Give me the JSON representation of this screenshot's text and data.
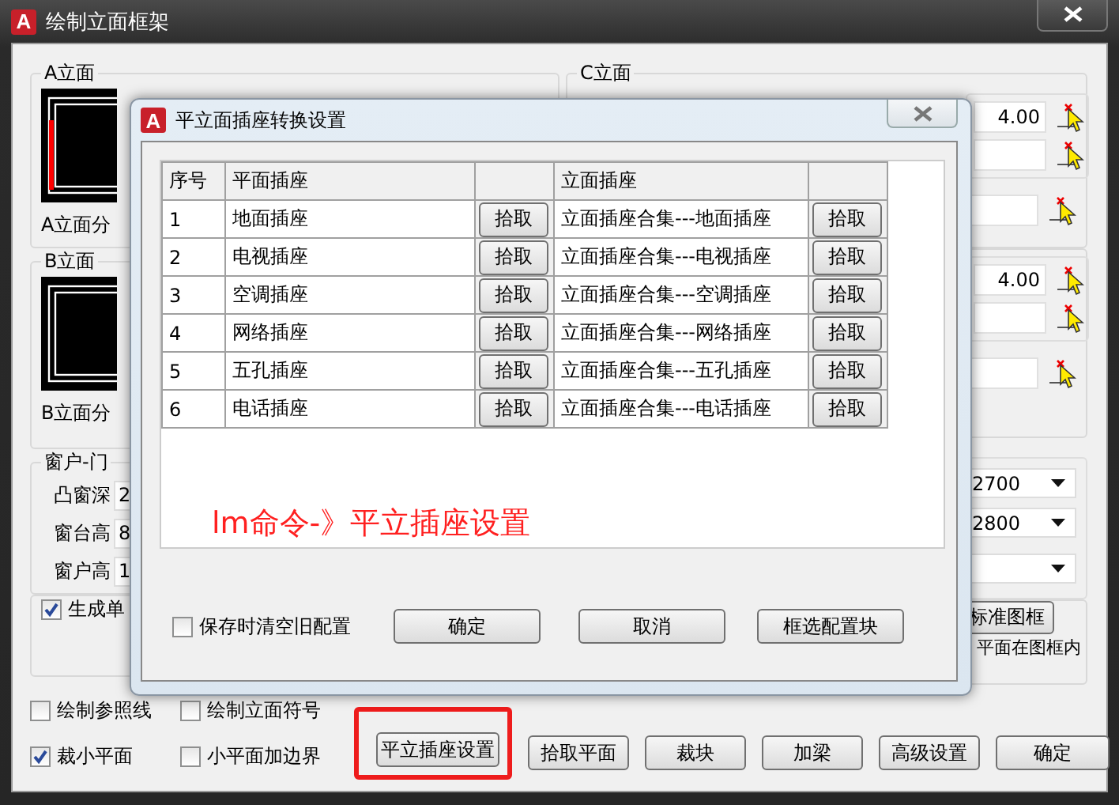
{
  "main_window": {
    "logo": "A",
    "title": "绘制立面框架"
  },
  "left_groups": [
    {
      "label": "A立面",
      "divider_label": "A立面分",
      "red_edge": true
    },
    {
      "label": "B立面",
      "divider_label": "B立面分",
      "red_edge": false
    }
  ],
  "right_groups": [
    {
      "label": "C立面",
      "rows": [
        {
          "kind": "filled",
          "value": "4.00"
        },
        {
          "kind": "empty"
        },
        {
          "kind": "empty"
        }
      ]
    },
    {
      "rows": [
        {
          "kind": "filled",
          "value": "4.00"
        },
        {
          "kind": "empty"
        },
        {
          "kind": "empty"
        }
      ]
    }
  ],
  "window_door": {
    "label": "窗户-门",
    "rows": [
      {
        "label": "凸窗深",
        "value": "2"
      },
      {
        "label": "窗台高",
        "value": "8"
      },
      {
        "label": "窗户高",
        "value": "1"
      }
    ]
  },
  "dropdowns": [
    {
      "kind": "filled",
      "value": "2700"
    },
    {
      "kind": "filled",
      "value": "2800"
    },
    {
      "kind": "empty"
    }
  ],
  "frame_group": {
    "checkbox": {
      "label": "生成单",
      "checked": true
    },
    "button": "标准图框",
    "note": "平面在图框内"
  },
  "options": [
    {
      "label": "绘制参照线",
      "checked": false
    },
    {
      "label": "绘制立面符号",
      "checked": false
    },
    {
      "label": "裁小平面",
      "checked": true
    },
    {
      "label": "小平面加边界",
      "checked": false
    }
  ],
  "buttons": [
    {
      "label": "平立插座设置",
      "highlighted": true
    },
    {
      "label": "拾取平面",
      "highlighted": false
    },
    {
      "label": "裁块",
      "highlighted": false
    },
    {
      "label": "加梁",
      "highlighted": false
    },
    {
      "label": "高级设置",
      "highlighted": false
    },
    {
      "label": "确定",
      "highlighted": false
    }
  ],
  "dialog": {
    "logo": "A",
    "title": "平立面插座转换设置",
    "columns": {
      "index": "序号",
      "plan": "平面插座",
      "elevation": "立面插座"
    },
    "rows": [
      {
        "index": "1",
        "plan": "地面插座",
        "plan_button": "拾取",
        "elevation": "立面插座合集---地面插座",
        "elevation_button": "拾取"
      },
      {
        "index": "2",
        "plan": "电视插座",
        "plan_button": "拾取",
        "elevation": "立面插座合集---电视插座",
        "elevation_button": "拾取"
      },
      {
        "index": "3",
        "plan": "空调插座",
        "plan_button": "拾取",
        "elevation": "立面插座合集---空调插座",
        "elevation_button": "拾取"
      },
      {
        "index": "4",
        "plan": "网络插座",
        "plan_button": "拾取",
        "elevation": "立面插座合集---网络插座",
        "elevation_button": "拾取"
      },
      {
        "index": "5",
        "plan": "五孔插座",
        "plan_button": "拾取",
        "elevation": "立面插座合集---五孔插座",
        "elevation_button": "拾取"
      },
      {
        "index": "6",
        "plan": "电话插座",
        "plan_button": "拾取",
        "elevation": "立面插座合集---电话插座",
        "elevation_button": "拾取"
      }
    ],
    "annotation": "lm命令-》平立插座设置",
    "clear_old": {
      "label": "保存时清空旧配置",
      "checked": false
    },
    "buttons": [
      "确定",
      "取消",
      "框选配置块"
    ]
  }
}
